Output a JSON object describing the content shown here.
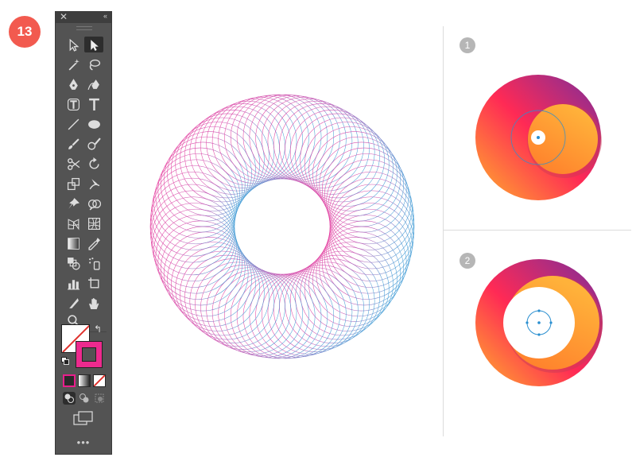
{
  "step": {
    "label": "13"
  },
  "toolbar": {
    "close_glyph": "✕",
    "collapse_glyph": "‹‹",
    "more_glyph": "•••",
    "swap_glyph": "↰",
    "tools": [
      "selection-tool",
      "direct-selection-tool",
      "magic-wand-tool",
      "lasso-tool",
      "pen-tool",
      "curvature-tool",
      "touch-type-tool",
      "type-tool",
      "line-segment-tool",
      "ellipse-tool",
      "paintbrush-tool",
      "shaper-tool",
      "scissors-tool",
      "rotate-tool",
      "scale-tool",
      "warp-tool",
      "pin-tool",
      "shape-builder-tool",
      "perspective-grid-tool",
      "mesh-tool",
      "gradient-tool",
      "eyedropper-tool",
      "blend-tool",
      "symbol-sprayer-tool",
      "column-graph-tool",
      "artboard-tool",
      "slice-tool",
      "hand-tool",
      "zoom-tool"
    ],
    "colors": {
      "fill": "#ffffff",
      "stroke": "#ed2a8e",
      "none_slash": "#e0322e",
      "bg": "#535353"
    }
  },
  "steps": [
    {
      "label": "1"
    },
    {
      "label": "2"
    }
  ],
  "colors": {
    "badge": "#f25a4f",
    "wire_a": "#e91e8c",
    "wire_b": "#2a8fd0",
    "grad_1": "#ff9e2c",
    "grad_2": "#ff2a55",
    "grad_3": "#7a2d9c"
  }
}
